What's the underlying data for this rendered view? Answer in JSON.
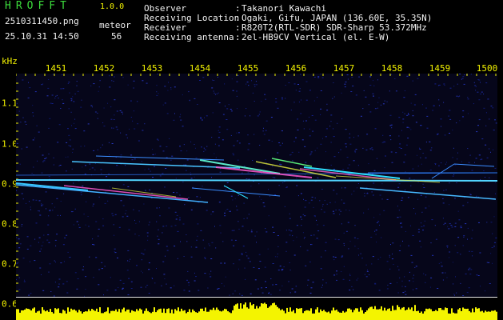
{
  "header": {
    "app_title": "HROFFT",
    "app_version": "1.0.0",
    "file_name": "2510311450.png",
    "event_type": "meteor",
    "event_count": "56",
    "date_time": "25.10.31 14:50"
  },
  "info": [
    {
      "label": "Observer",
      "value": "Takanori Kawachi"
    },
    {
      "label": "Receiving Location",
      "value": "Ogaki, Gifu, JAPAN (136.60E, 35.35N)"
    },
    {
      "label": "Receiver",
      "value": "R820T2(RTL-SDR) SDR-Sharp 53.372MHz"
    },
    {
      "label": "Receiving antenna",
      "value": "2el-HB9CV Vertical (el. E-W)"
    }
  ],
  "info_separator": ":",
  "axes": {
    "y_unit": "kHz",
    "x_ticks": [
      "1451",
      "1452",
      "1453",
      "1454",
      "1455",
      "1456",
      "1457",
      "1458",
      "1459",
      "1500"
    ],
    "y_ticks": [
      "1.1",
      "1.0",
      "0.9",
      "0.8",
      "0.7",
      "0.6"
    ]
  },
  "colors": {
    "background": "#000000",
    "header_green": "#3cdc3c",
    "axis_yellow": "#f2f200",
    "noise_blue": "#1c2ca0",
    "carrier_cyan": "#5ad8ff",
    "level_yellow": "#f4f400"
  }
}
